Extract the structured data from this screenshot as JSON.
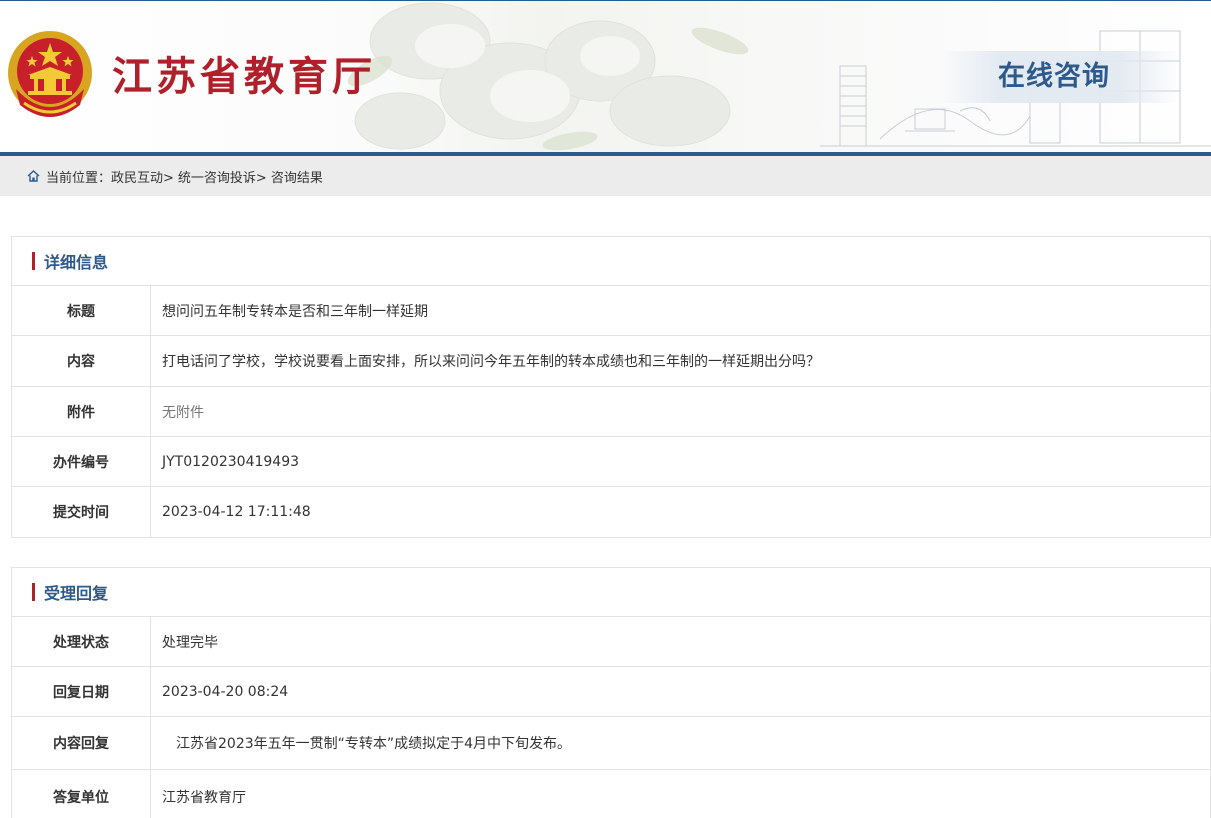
{
  "header": {
    "site_title": "江苏省教育厅",
    "section_badge": "在线咨询",
    "icons": {
      "emblem": "national-emblem"
    }
  },
  "breadcrumb": {
    "icon": "home-icon",
    "items": [
      "当前位置：政民互动>",
      "统一咨询投诉>",
      "咨询结果"
    ]
  },
  "details": {
    "heading": "详细信息",
    "rows": [
      {
        "label": "标题",
        "value": "想问问五年制专转本是否和三年制一样延期"
      },
      {
        "label": "内容",
        "value": "打电话问了学校，学校说要看上面安排，所以来问问今年五年制的转本成绩也和三年制的一样延期出分吗？"
      },
      {
        "label": "附件",
        "value": "无附件"
      },
      {
        "label": "办件编号",
        "value": "JYT0120230419493"
      },
      {
        "label": "提交时间",
        "value": "2023-04-12 17:11:48"
      }
    ]
  },
  "reply": {
    "heading": "受理回复",
    "rows": [
      {
        "label": "处理状态",
        "value": "处理完毕"
      },
      {
        "label": "回复日期",
        "value": "2023-04-20 08:24"
      },
      {
        "label": "内容回复",
        "value": "　江苏省2023年五年一贯制“专转本”成绩拟定于4月中下旬发布。"
      },
      {
        "label": "答复单位",
        "value": "江苏省教育厅"
      }
    ]
  },
  "colors": {
    "brand_red": "#b0202a",
    "brand_blue": "#2c5b8f"
  }
}
